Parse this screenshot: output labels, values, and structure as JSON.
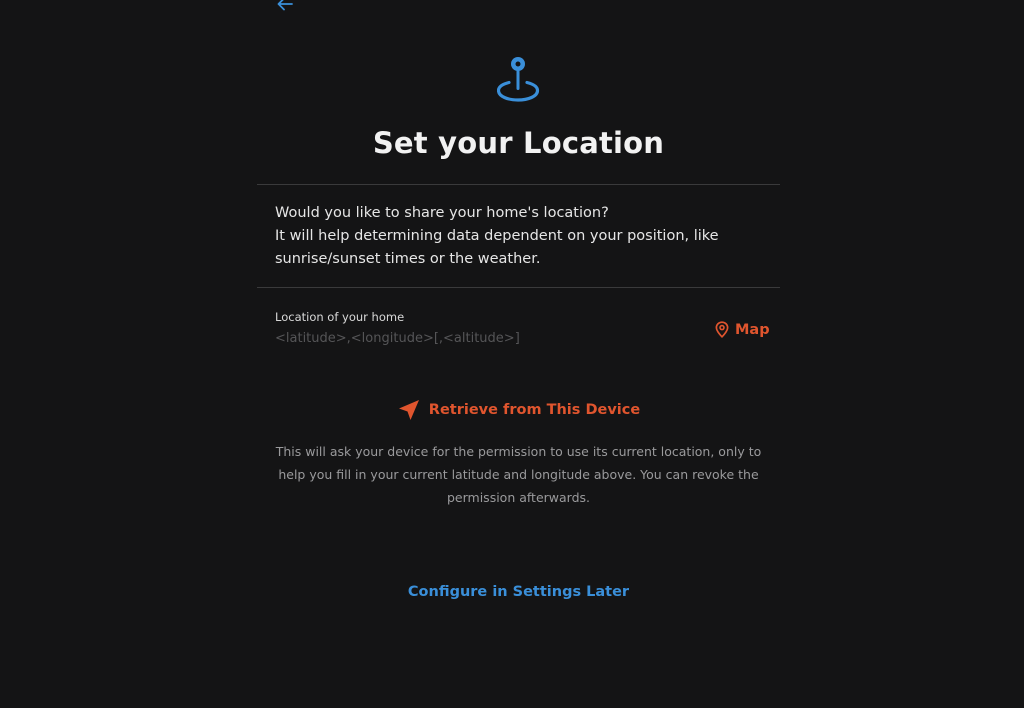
{
  "colors": {
    "background": "#141415",
    "accent_blue": "#3a8fd9",
    "accent_orange": "#e0552e",
    "divider": "#3a3a3b"
  },
  "header": {
    "back_icon": "arrow-left-icon",
    "hero_icon": "map-pin-icon"
  },
  "title": "Set your Location",
  "intro": {
    "line1": "Would you like to share your home's location?",
    "line2": "It will help determining data dependent on your position, like",
    "line3": "sunrise/sunset times or the weather."
  },
  "location_field": {
    "label": "Location of your home",
    "value": "",
    "placeholder": "<latitude>,<longitude>[,<altitude>]"
  },
  "map_button": {
    "icon": "map-marker-icon",
    "label": "Map"
  },
  "retrieve": {
    "icon": "navigation-arrow-icon",
    "label": "Retrieve from This Device",
    "note": "This will ask your device for the permission to use its current location, only to help you fill in your current latitude and longitude above. You can revoke the permission afterwards."
  },
  "configure_later": {
    "label": "Configure in Settings Later"
  }
}
